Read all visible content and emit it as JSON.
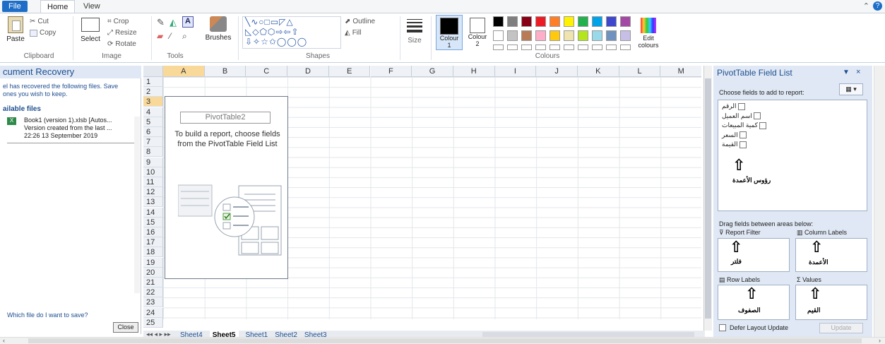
{
  "tabs": {
    "file": "File",
    "home": "Home",
    "view": "View"
  },
  "ribbon": {
    "clipboard": {
      "paste": "Paste",
      "cut": "Cut",
      "copy": "Copy",
      "label": "Clipboard"
    },
    "image": {
      "select": "Select",
      "crop": "Crop",
      "resize": "Resize",
      "rotate": "Rotate",
      "label": "Image"
    },
    "tools": {
      "brushes": "Brushes",
      "label": "Tools"
    },
    "shapes": {
      "outline": "Outline",
      "fill": "Fill",
      "label": "Shapes"
    },
    "size": "Size",
    "colours": {
      "colour1": "Colour",
      "colour1_num": "1",
      "colour2": "Colour",
      "colour2_num": "2",
      "edit": "Edit",
      "edit2": "colours",
      "label": "Colours"
    },
    "palette_row1": [
      "#000000",
      "#7f7f7f",
      "#880015",
      "#ed1c24",
      "#ff7f27",
      "#fff200",
      "#22b14c",
      "#00a2e8",
      "#3f48cc",
      "#a349a4"
    ],
    "palette_row2": [
      "#ffffff",
      "#c3c3c3",
      "#b97a57",
      "#ffaec9",
      "#ffc90e",
      "#efe4b0",
      "#b5e61d",
      "#99d9ea",
      "#7092be",
      "#c8bfe7"
    ]
  },
  "recovery": {
    "title": "cument Recovery",
    "desc1": "el has recovered the following files. Save",
    "desc2": "ones you wish to keep.",
    "available": "ailable files",
    "file_name": "Book1 (version 1).xlsb  [Autos...",
    "file_info1": "Version created from the last ...",
    "file_info2": "22:26 13 September 2019",
    "help_link": "Which file do I want to save?",
    "close": "Close"
  },
  "sheet": {
    "columns": [
      "A",
      "B",
      "C",
      "D",
      "E",
      "F",
      "G",
      "H",
      "I",
      "J",
      "K",
      "L",
      "M"
    ],
    "rows": [
      "1",
      "2",
      "3",
      "4",
      "5",
      "6",
      "7",
      "8",
      "9",
      "10",
      "11",
      "12",
      "13",
      "14",
      "15",
      "16",
      "17",
      "18",
      "19",
      "20",
      "21",
      "22",
      "23",
      "24",
      "25"
    ],
    "pivot_name": "PivotTable2",
    "pivot_hint": "To build a report, choose fields from the PivotTable Field List",
    "sheet_tabs": [
      "Sheet4",
      "Sheet5",
      "Sheet1",
      "Sheet2",
      "Sheet3"
    ],
    "active_tab": "Sheet5"
  },
  "fieldlist": {
    "title": "PivotTable Field List",
    "choose": "Choose fields to add to report:",
    "fields": [
      "الرقم",
      "اسم العميل",
      "كمية المبيعات",
      "السعر",
      "القيمة"
    ],
    "fields_note": "رؤوس الأعمدة",
    "drag": "Drag fields between areas below:",
    "report_filter": "Report Filter",
    "column_labels": "Column Labels",
    "row_labels": "Row Labels",
    "values": "Values",
    "filter_ar": "فلتر",
    "columns_ar": "الأعمدة",
    "rows_ar": "الصفوف",
    "values_ar": "القيم",
    "defer": "Defer Layout Update",
    "update": "Update",
    "arrow": "⇧"
  }
}
